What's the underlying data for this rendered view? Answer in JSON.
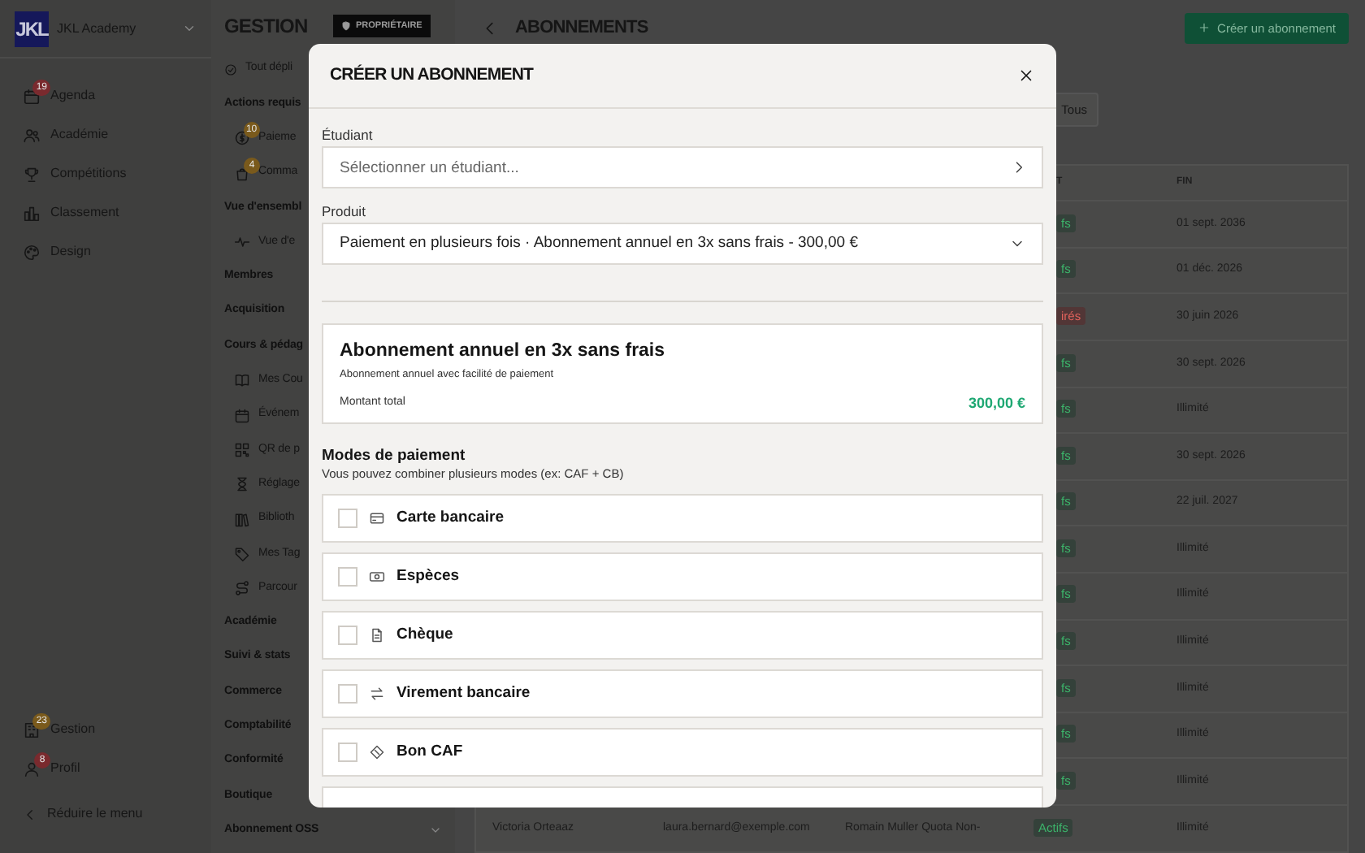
{
  "sidebar": {
    "logo": "JKL",
    "academy": "JKL Academy",
    "items": [
      {
        "label": "Agenda",
        "badge": "19",
        "color": "#7a2a2e"
      },
      {
        "label": "Académie"
      },
      {
        "label": "Compétitions"
      },
      {
        "label": "Classement"
      },
      {
        "label": "Design"
      }
    ],
    "bottom_items": [
      {
        "label": "Gestion",
        "badge": "23",
        "color": "#7a5a1c"
      },
      {
        "label": "Profil",
        "badge": "8",
        "color": "#7a2a2e"
      }
    ],
    "collapse": "Réduire le menu"
  },
  "section_nav": {
    "title": "GESTION",
    "role_badge": "PROPRIÉTAIRE",
    "items": [
      {
        "kind": "action",
        "label": "Tout dépli"
      },
      {
        "kind": "heading",
        "label": "Actions requis"
      },
      {
        "kind": "item",
        "label": "Paieme",
        "badge": "10",
        "color": "#7a5a1c"
      },
      {
        "kind": "item",
        "label": "Comma",
        "badge": "4",
        "color": "#7a5a1c"
      },
      {
        "kind": "heading",
        "label": "Vue d'ensembl"
      },
      {
        "kind": "item",
        "label": "Vue d'e"
      },
      {
        "kind": "heading",
        "label": "Membres"
      },
      {
        "kind": "heading",
        "label": "Acquisition"
      },
      {
        "kind": "heading",
        "label": "Cours & pédag"
      },
      {
        "kind": "item",
        "label": "Mes Cou"
      },
      {
        "kind": "item",
        "label": "Événem"
      },
      {
        "kind": "item",
        "label": "QR de p"
      },
      {
        "kind": "item",
        "label": "Réglage"
      },
      {
        "kind": "item",
        "label": "Biblioth"
      },
      {
        "kind": "item",
        "label": "Mes Tag"
      },
      {
        "kind": "item",
        "label": "Parcour"
      },
      {
        "kind": "heading",
        "label": "Académie"
      },
      {
        "kind": "heading",
        "label": "Suivi & stats"
      },
      {
        "kind": "heading",
        "label": "Commerce"
      },
      {
        "kind": "heading",
        "label": "Comptabilité"
      },
      {
        "kind": "heading",
        "label": "Conformité"
      },
      {
        "kind": "heading",
        "label": "Boutique"
      },
      {
        "kind": "group",
        "label": "Abonnement OSS",
        "expanded": false
      }
    ]
  },
  "main": {
    "title": "ABONNEMENTS",
    "create_button": "Créer un abonnement",
    "filter": "Tous",
    "table": {
      "columns": [
        "T",
        "FIN"
      ],
      "rows": [
        {
          "status": "fs",
          "expired": false,
          "end": "01 sept. 2036"
        },
        {
          "status": "fs",
          "expired": false,
          "end": "01 déc. 2026"
        },
        {
          "status": "irés",
          "expired": true,
          "end": "30 juin 2026"
        },
        {
          "status": "fs",
          "expired": false,
          "end": "30 sept. 2026"
        },
        {
          "status": "fs",
          "expired": false,
          "end": "Illimité"
        },
        {
          "status": "fs",
          "expired": false,
          "end": "30 sept. 2026"
        },
        {
          "status": "fs",
          "expired": false,
          "end": "22 juil. 2027"
        },
        {
          "status": "fs",
          "expired": false,
          "end": "Illimité"
        },
        {
          "status": "fs",
          "expired": false,
          "end": "Illimité"
        },
        {
          "status": "fs",
          "expired": false,
          "end": "Illimité"
        },
        {
          "status": "fs",
          "expired": false,
          "end": "Illimité"
        },
        {
          "status": "fs",
          "expired": false,
          "end": "Illimité"
        },
        {
          "status": "fs",
          "expired": false,
          "end": "Illimité"
        },
        {
          "name": "Victoria Orteaaz",
          "email": "laura.bernard@exemple.com",
          "product": "Romain Muller Quota Non-",
          "status": "Actifs",
          "expired": false,
          "end": "Illimité"
        }
      ]
    }
  },
  "modal": {
    "title": "CRÉER UN ABONNEMENT",
    "student": {
      "label": "Étudiant",
      "placeholder": "Sélectionner un étudiant..."
    },
    "product": {
      "label": "Produit",
      "value": "Paiement en plusieurs fois · Abonnement annuel en 3x sans frais - 300,00 €"
    },
    "summary": {
      "title": "Abonnement annuel en 3x sans frais",
      "description": "Abonnement annuel avec facilité de paiement",
      "total_label": "Montant total",
      "total": "300,00 €"
    },
    "payment": {
      "title": "Modes de paiement",
      "hint": "Vous pouvez combiner plusieurs modes (ex: CAF + CB)",
      "options": [
        {
          "label": "Carte bancaire",
          "checked": false
        },
        {
          "label": "Espèces",
          "checked": false
        },
        {
          "label": "Chèque",
          "checked": false
        },
        {
          "label": "Virement bancaire",
          "checked": false
        },
        {
          "label": "Bon CAF",
          "checked": false
        }
      ]
    }
  }
}
